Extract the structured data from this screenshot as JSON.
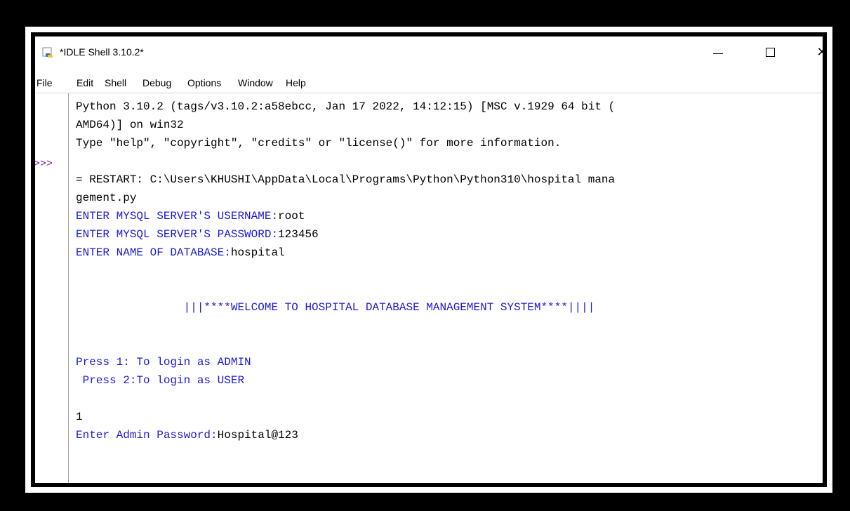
{
  "window": {
    "title": "*IDLE Shell 3.10.2*",
    "controls": {
      "minimize": "—",
      "maximize": "□",
      "close": "✕"
    }
  },
  "menu": [
    "File",
    "Edit",
    "Shell",
    "Debug",
    "Options",
    "Window",
    "Help"
  ],
  "shell": {
    "prompt": ">>>",
    "lines": [
      {
        "text": "Python 3.10.2 (tags/v3.10.2:a58ebcc, Jan 17 2022, 14:12:15) [MSC v.1929 64 bit (",
        "color": "black"
      },
      {
        "text": "AMD64)] on win32",
        "color": "black"
      },
      {
        "text": "Type \"help\", \"copyright\", \"credits\" or \"license()\" for more information.",
        "color": "black"
      },
      {
        "text": "",
        "color": "black"
      },
      {
        "text": "= RESTART: C:\\Users\\KHUSHI\\AppData\\Local\\Programs\\Python\\Python310\\hospital mana",
        "color": "black"
      },
      {
        "text": "gement.py",
        "color": "black"
      },
      {
        "text": "ENTER MYSQL SERVER'S USERNAME:",
        "color": "blue",
        "input": "root"
      },
      {
        "text": "ENTER MYSQL SERVER'S PASSWORD:",
        "color": "blue",
        "input": "123456"
      },
      {
        "text": "ENTER NAME OF DATABASE:",
        "color": "blue",
        "input": "hospital"
      },
      {
        "text": "",
        "color": "black"
      },
      {
        "text": "",
        "color": "black"
      },
      {
        "text": "                |||****WELCOME TO HOSPITAL DATABASE MANAGEMENT SYSTEM****||||",
        "color": "blue"
      },
      {
        "text": "",
        "color": "black"
      },
      {
        "text": "",
        "color": "black"
      },
      {
        "text": "Press 1: To login as ADMIN",
        "color": "blue"
      },
      {
        "text": " Press 2:To login as USER",
        "color": "blue"
      },
      {
        "text": "",
        "color": "black"
      },
      {
        "text": "1",
        "color": "black"
      },
      {
        "text": "Enter Admin Password:",
        "color": "blue",
        "input": "Hospital@123"
      }
    ]
  },
  "colors": {
    "output_blue": "#1a1ad6",
    "prompt_purple": "#7c1b9c"
  }
}
